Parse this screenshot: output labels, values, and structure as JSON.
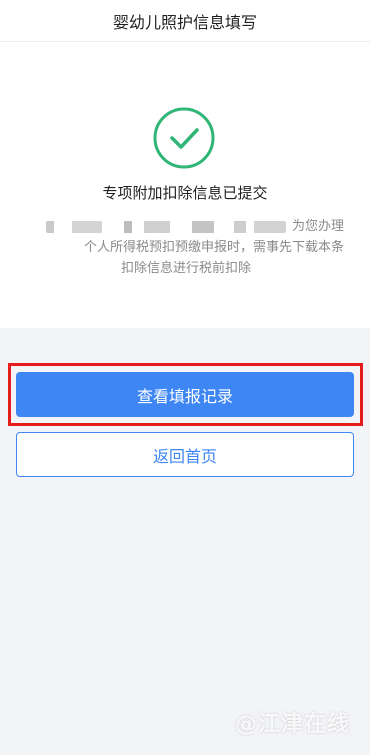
{
  "header": {
    "title": "婴幼儿照护信息填写"
  },
  "result": {
    "title": "专项附加扣除信息已提交",
    "description_line1": "为您办理",
    "description_line2": "个人所得税预扣预缴申报时，需事先下载本条",
    "description_line3": "扣除信息进行税前扣除"
  },
  "buttons": {
    "view_records": "查看填报记录",
    "back_home": "返回首页"
  },
  "watermark": "@江津在线",
  "colors": {
    "accent": "#3d86f4",
    "success": "#2fb575",
    "highlight": "#e51c1c"
  },
  "icons": {
    "status": "check-circle-icon"
  }
}
